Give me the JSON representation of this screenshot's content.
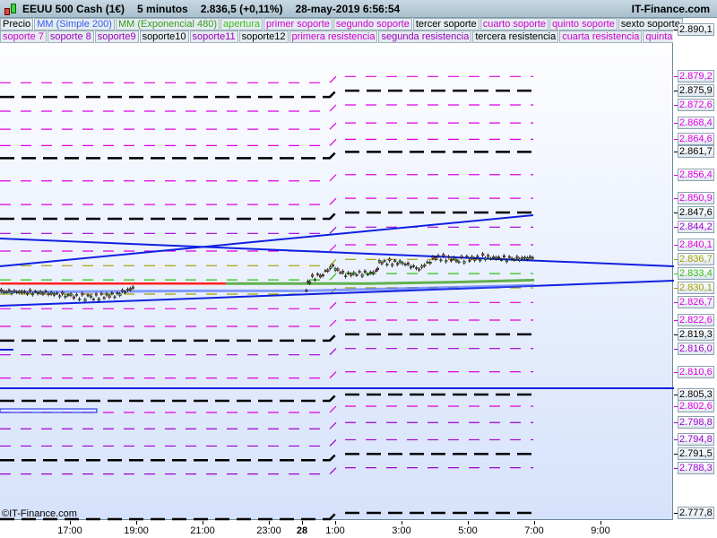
{
  "header": {
    "instrument": "EEUU 500 Cash (1€)",
    "timeframe": "5 minutos",
    "price": "2.836,5 (+0,11%)",
    "datetime": "28-may-2019 6:56:54",
    "brand": "IT-Finance.com"
  },
  "legend_row1": [
    {
      "label": "Precio",
      "color": "#000000"
    },
    {
      "label": "MM (Simple 200)",
      "color": "#3a5cf0"
    },
    {
      "label": "MM (Exponencial 480)",
      "color": "#3a9a20"
    },
    {
      "label": "apertura",
      "color": "#40c020"
    },
    {
      "label": "primer soporte",
      "color": "#d000d0"
    },
    {
      "label": "segundo soporte",
      "color": "#d000d0"
    },
    {
      "label": "tercer soporte",
      "color": "#000000"
    },
    {
      "label": "cuarto soporte",
      "color": "#d000d0"
    },
    {
      "label": "quinto soporte",
      "color": "#d000d0"
    },
    {
      "label": "sexto soporte",
      "color": "#000000"
    }
  ],
  "legend_row2": [
    {
      "label": "soporte 7",
      "color": "#d000d0"
    },
    {
      "label": "soporte 8",
      "color": "#a000c0"
    },
    {
      "label": "soporte9",
      "color": "#a000c0"
    },
    {
      "label": "soporte10",
      "color": "#000000"
    },
    {
      "label": "soporte11",
      "color": "#a000c0"
    },
    {
      "label": "soporte12",
      "color": "#000000"
    },
    {
      "label": "primera resistencia",
      "color": "#d000d0"
    },
    {
      "label": "segunda resistencia",
      "color": "#a000c0"
    },
    {
      "label": "tercera resistencia",
      "color": "#000000"
    },
    {
      "label": "cuarta resistencia",
      "color": "#d000d0"
    },
    {
      "label": "quinta resi",
      "color": "#d000d0"
    }
  ],
  "axis_top_label": "2.890,1",
  "levels": [
    {
      "label": "2.879,2",
      "price": 2879.2,
      "color": "#e000e0"
    },
    {
      "label": "2.875,9",
      "price": 2875.9,
      "color": "#000000"
    },
    {
      "label": "2.872,6",
      "price": 2872.6,
      "color": "#e000e0"
    },
    {
      "label": "2.868,4",
      "price": 2868.4,
      "color": "#e000e0"
    },
    {
      "label": "2.864,6",
      "price": 2864.6,
      "color": "#e000e0"
    },
    {
      "label": "2.861,7",
      "price": 2861.7,
      "color": "#000000"
    },
    {
      "label": "2.856,4",
      "price": 2856.4,
      "color": "#e000e0"
    },
    {
      "label": "2.850,9",
      "price": 2850.9,
      "color": "#e000e0"
    },
    {
      "label": "2.847,6",
      "price": 2847.6,
      "color": "#000000"
    },
    {
      "label": "2.844,2",
      "price": 2844.2,
      "color": "#a000d0"
    },
    {
      "label": "2.840,1",
      "price": 2840.1,
      "color": "#e000e0"
    },
    {
      "label": "2.836,7",
      "price": 2836.7,
      "color": "#a0a000"
    },
    {
      "label": "2.833,4",
      "price": 2833.4,
      "color": "#30c010"
    },
    {
      "label": "2.830,1",
      "price": 2830.1,
      "color": "#a0a000"
    },
    {
      "label": "2.826,7",
      "price": 2826.7,
      "color": "#e000e0"
    },
    {
      "label": "2.822,6",
      "price": 2822.6,
      "color": "#e000e0"
    },
    {
      "label": "2.819,3",
      "price": 2819.3,
      "color": "#000000"
    },
    {
      "label": "2.816,0",
      "price": 2816.0,
      "color": "#a000d0"
    },
    {
      "label": "2.810,6",
      "price": 2810.6,
      "color": "#e000e0"
    },
    {
      "label": "2.805,3",
      "price": 2805.3,
      "color": "#000000"
    },
    {
      "label": "2.802,6",
      "price": 2802.6,
      "color": "#e000e0"
    },
    {
      "label": "2.798,8",
      "price": 2798.8,
      "color": "#a000d0"
    },
    {
      "label": "2.794,8",
      "price": 2794.8,
      "color": "#a000d0"
    },
    {
      "label": "2.791,5",
      "price": 2791.5,
      "color": "#000000"
    },
    {
      "label": "2.788,3",
      "price": 2788.3,
      "color": "#a000d0"
    },
    {
      "label": "2.777,8",
      "price": 2777.8,
      "color": "#000000"
    }
  ],
  "price_series": [
    [
      -1.1,
      2829.3
    ],
    [
      0.24,
      2828.9
    ],
    [
      1.0,
      2828.2
    ],
    [
      1.6,
      2827.8
    ],
    [
      2.4,
      2828.6
    ],
    [
      2.95,
      2830.3
    ],
    [
      8.1,
      2829.9
    ],
    [
      8.2,
      2832.0
    ],
    [
      8.6,
      2833.4
    ],
    [
      8.9,
      2835.1
    ],
    [
      9.2,
      2833.2
    ],
    [
      10.2,
      2833.6
    ],
    [
      10.3,
      2836.1
    ],
    [
      11.0,
      2835.9
    ],
    [
      11.5,
      2834.5
    ],
    [
      12.0,
      2837.2
    ],
    [
      12.7,
      2836.6
    ],
    [
      13.5,
      2837.2
    ],
    [
      14.3,
      2836.8
    ],
    [
      15.0,
      2837.2
    ]
  ],
  "ma_simple_200": [
    [
      -1.1,
      2829.1
    ],
    [
      5,
      2829.4
    ],
    [
      8,
      2829.4
    ],
    [
      12,
      2830.1
    ],
    [
      15,
      2830.7
    ]
  ],
  "ma_exp_480": [
    [
      5.7,
      2831.1
    ],
    [
      10,
      2831.1
    ],
    [
      12.5,
      2831.4
    ],
    [
      15,
      2831.9
    ]
  ],
  "opening_line": [
    [
      -1.1,
      2831.1
    ],
    [
      5.7,
      2831.1
    ]
  ],
  "time_labels": [
    {
      "label": "17:00",
      "h": 1
    },
    {
      "label": "19:00",
      "h": 3
    },
    {
      "label": "21:00",
      "h": 5
    },
    {
      "label": "23:00",
      "h": 7
    },
    {
      "label": "28",
      "h": 8,
      "bold": true
    },
    {
      "label": "1:00",
      "h": 9
    },
    {
      "label": "3:00",
      "h": 11
    },
    {
      "label": "5:00",
      "h": 13
    },
    {
      "label": "7:00",
      "h": 15
    },
    {
      "label": "9:00",
      "h": 17
    }
  ],
  "copyright": "©IT-Finance.com",
  "colors": {
    "trend": "#1020e0",
    "ma_simple": "#4060ff",
    "ma_exp": "#40a020",
    "opening": "#ff2020"
  }
}
